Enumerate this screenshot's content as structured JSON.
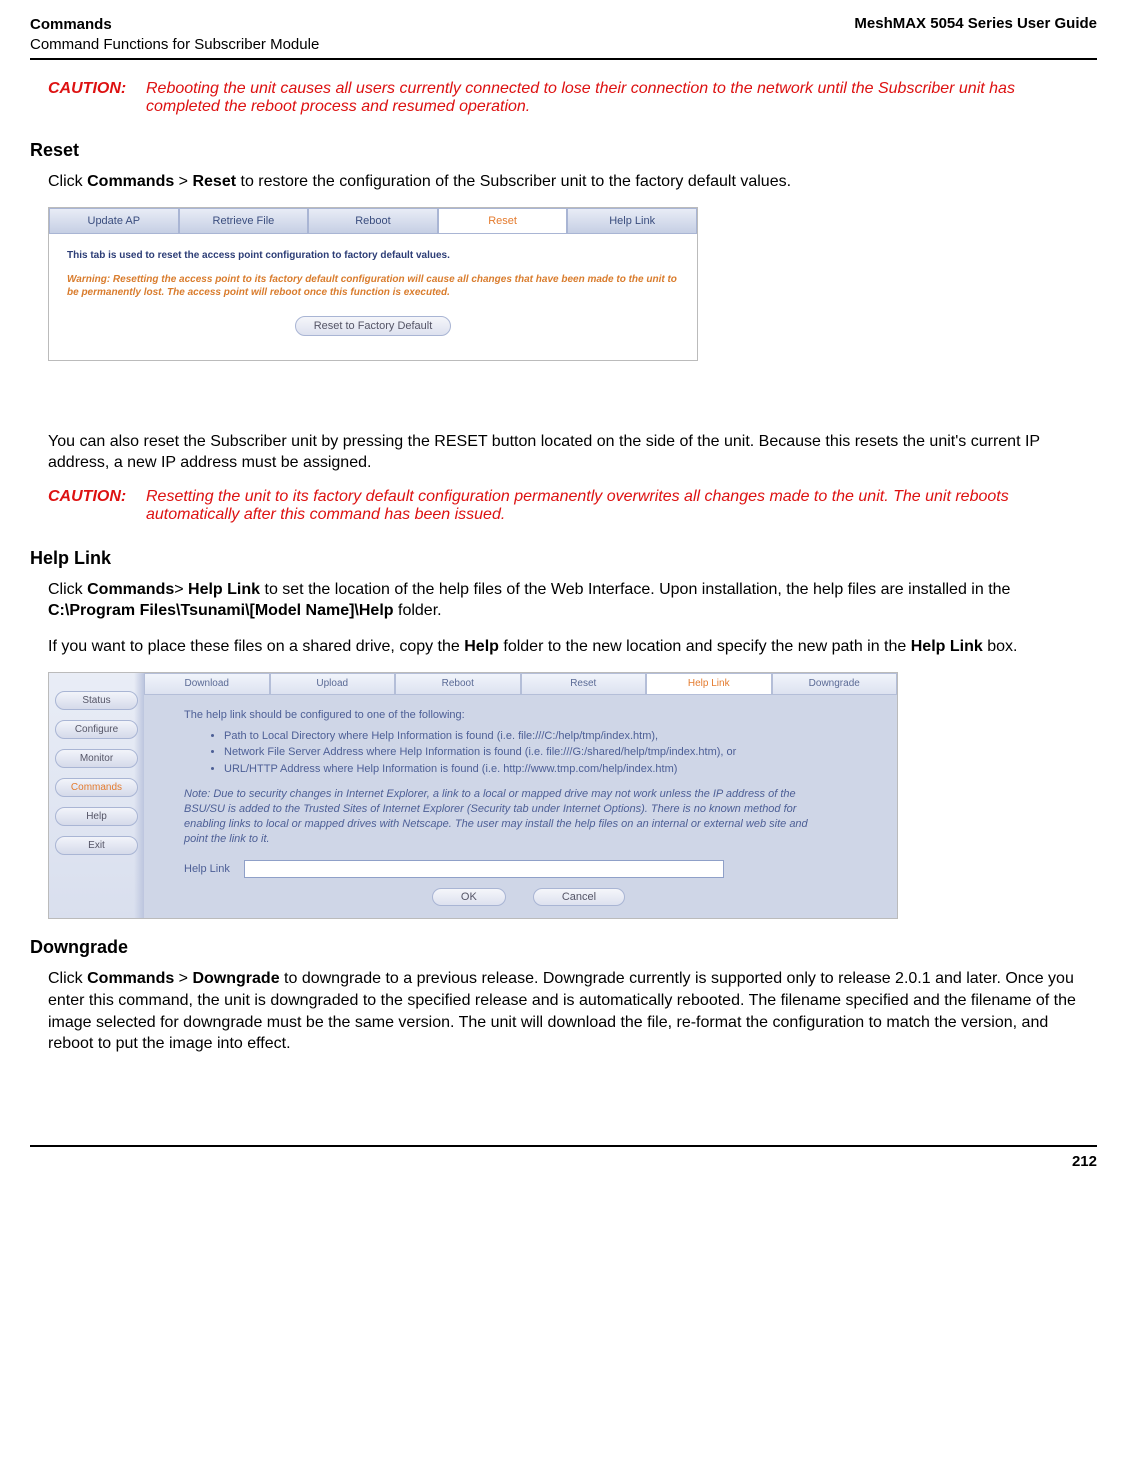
{
  "header": {
    "left_line1": "Commands",
    "left_line2": "Command Functions for Subscriber Module",
    "right": "MeshMAX 5054 Series User Guide"
  },
  "caution1": {
    "label": "CAUTION:",
    "text": "Rebooting the unit causes all users currently connected to lose their connection to the network until the Subscriber unit has completed the reboot process and resumed operation."
  },
  "reset": {
    "title": "Reset",
    "p1_a": "Click ",
    "p1_b": "Commands",
    "p1_c": " > ",
    "p1_d": "Reset",
    "p1_e": " to restore the configuration of the Subscriber unit to the factory default values.",
    "p2": "You can also reset the Subscriber unit by pressing the RESET button located on the side of the unit. Because this resets the unit's current IP address, a new IP address must be assigned."
  },
  "shot1": {
    "tabs": [
      "Update AP",
      "Retrieve File",
      "Reboot",
      "Reset",
      "Help Link"
    ],
    "active_index": 3,
    "line1": "This tab is used to reset the access point configuration to factory default values.",
    "warn": "Warning: Resetting the access point to its factory default configuration will cause all changes that have been made to the unit to be permanently lost. The access point will reboot once this function is executed.",
    "button": "Reset to Factory Default"
  },
  "caution2": {
    "label": "CAUTION:",
    "text": "Resetting the unit to its factory default configuration permanently overwrites all changes made to the unit. The unit reboots automatically after this command has been issued."
  },
  "helplink": {
    "title": "Help Link",
    "p1_a": "Click ",
    "p1_b": "Commands",
    "p1_c": "> ",
    "p1_d": "Help Link",
    "p1_e": " to set the location of the help files of the Web Interface. Upon installation, the help files are installed in the ",
    "p1_f": "C:\\Program Files\\Tsunami\\[Model Name]\\Help",
    "p1_g": " folder.",
    "p2_a": "If you want to place these files on a shared drive, copy the ",
    "p2_b": "Help",
    "p2_c": " folder to the new location and specify the new path in the ",
    "p2_d": "Help Link",
    "p2_e": " box."
  },
  "shot2": {
    "side": [
      "Status",
      "Configure",
      "Monitor",
      "Commands",
      "Help",
      "Exit"
    ],
    "side_active_index": 3,
    "tabs": [
      "Download",
      "Upload",
      "Reboot",
      "Reset",
      "Help Link",
      "Downgrade"
    ],
    "tabs_active_index": 4,
    "intro": "The help link should be configured to one of the following:",
    "bullets": [
      "Path to Local Directory where Help Information is found (i.e. file:///C:/help/tmp/index.htm),",
      "Network File Server Address where Help Information is found (i.e. file:///G:/shared/help/tmp/index.htm), or",
      "URL/HTTP Address where Help Information is found (i.e. http://www.tmp.com/help/index.htm)"
    ],
    "note": "Note: Due to security changes in Internet Explorer, a link to a local or mapped drive may not work unless the IP address of the BSU/SU is added to the Trusted Sites of Internet Explorer (Security tab under Internet Options). There is no known method for enabling links to local or mapped drives with Netscape. The user may install the help files on an internal or external web site and point the link to it.",
    "field_label": "Help Link",
    "field_value": "",
    "ok": "OK",
    "cancel": "Cancel"
  },
  "downgrade": {
    "title": "Downgrade",
    "p1_a": "Click ",
    "p1_b": "Commands",
    "p1_c": " > ",
    "p1_d": "Downgrade",
    "p1_e": " to downgrade to a previous release. Downgrade currently is supported only to release 2.0.1 and later. Once you enter this command, the unit is downgraded to the specified release and is automatically rebooted. The filename specified and the filename of the image selected for downgrade must be the same version. The unit will download the file, re-format the configuration to match the version, and reboot to put the image into effect."
  },
  "footer": {
    "page": "212"
  }
}
